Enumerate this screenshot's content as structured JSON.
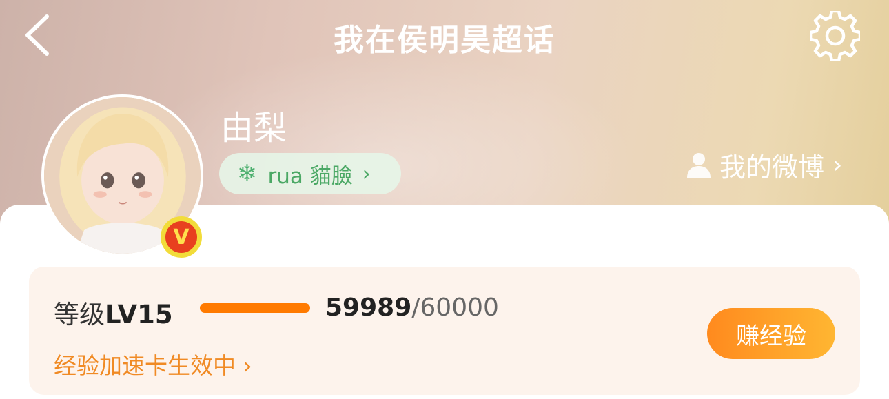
{
  "header": {
    "title": "我在侯明昊超话",
    "back_icon": "back-chevron-icon",
    "settings_icon": "gear-icon"
  },
  "profile": {
    "name": "由梨",
    "fan_badge": {
      "icon": "snowflake-icon",
      "label": "rua 貓臉",
      "chevron": "›"
    },
    "my_weibo": {
      "icon": "person-icon",
      "label": "我的微博",
      "chevron": "›"
    },
    "vip_badge": "V"
  },
  "level": {
    "label_prefix": "等级",
    "level": "LV15",
    "progress_fraction": 0.9998,
    "exp_current": "59989",
    "exp_total": "/60000",
    "boost_text": "经验加速卡生效中 ›",
    "earn_button": "赚经验"
  },
  "colors": {
    "accent_orange": "#ff7a00",
    "badge_green": "#4ba865",
    "vip_red": "#e8401f",
    "vip_yellow": "#f2dc3a"
  }
}
